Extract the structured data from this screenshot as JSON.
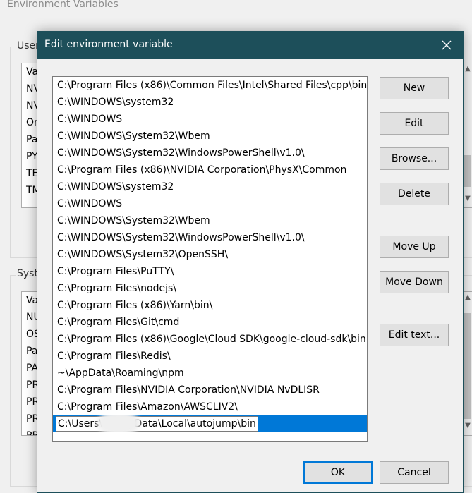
{
  "background": {
    "window_title": "Environment Variables",
    "user_group_label": "User",
    "system_group_label": "Syste",
    "user_rows": [
      "Va",
      "NV",
      "NV",
      "On",
      "Pa",
      "PY",
      "TE",
      "TM"
    ],
    "system_rows": [
      "Va",
      "NU",
      "OS",
      "Pa",
      "PA",
      "PR",
      "PR",
      "PR",
      "PR"
    ]
  },
  "dialog": {
    "title": "Edit environment variable",
    "paths": [
      "C:\\Program Files (x86)\\Common Files\\Intel\\Shared Files\\cpp\\bin...",
      "C:\\WINDOWS\\system32",
      "C:\\WINDOWS",
      "C:\\WINDOWS\\System32\\Wbem",
      "C:\\WINDOWS\\System32\\WindowsPowerShell\\v1.0\\",
      "C:\\Program Files (x86)\\NVIDIA Corporation\\PhysX\\Common",
      "C:\\WINDOWS\\system32",
      "C:\\WINDOWS",
      "C:\\WINDOWS\\System32\\Wbem",
      "C:\\WINDOWS\\System32\\WindowsPowerShell\\v1.0\\",
      "C:\\WINDOWS\\System32\\OpenSSH\\",
      "C:\\Program Files\\PuTTY\\",
      "C:\\Program Files\\nodejs\\",
      "C:\\Program Files (x86)\\Yarn\\bin\\",
      "C:\\Program Files\\Git\\cmd",
      "C:\\Program Files (x86)\\Google\\Cloud SDK\\google-cloud-sdk\\bin",
      "C:\\Program Files\\Redis\\",
      "~\\AppData\\Roaming\\npm",
      "C:\\Program Files\\NVIDIA Corporation\\NVIDIA NvDLISR",
      "C:\\Program Files\\Amazon\\AWSCLIV2\\"
    ],
    "editing_value": "C:\\Users\\          p\\AppData\\Local\\autojump\\bin",
    "buttons": {
      "new": "New",
      "edit": "Edit",
      "browse": "Browse...",
      "delete": "Delete",
      "move_up": "Move Up",
      "move_down": "Move Down",
      "edit_text": "Edit text...",
      "ok": "OK",
      "cancel": "Cancel"
    }
  },
  "colors": {
    "titlebar": "#1d4f5a",
    "selection": "#0078d7"
  },
  "icons": {
    "close": "close-icon"
  }
}
